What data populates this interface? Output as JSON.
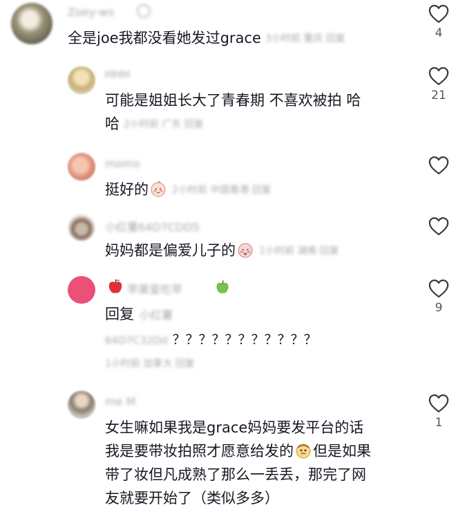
{
  "colors": {
    "text": "#161823",
    "meta": "#a8a9ad",
    "heart": "#3a3a44",
    "count": "#555560"
  },
  "comments": [
    {
      "username": "Zoey-ws",
      "text": "全是joe我都没看她发过grace",
      "meta": "3小时前 重庆 回复",
      "likes": "4"
    },
    {
      "username": "HHH",
      "text_line1": "可能是姐姐长大了青春期 不喜欢被拍 哈",
      "text_line2": "哈",
      "meta": "2小时前 广东 回复",
      "likes": "21"
    },
    {
      "username": "momo",
      "text": "挺好的",
      "meta": "2小时前 中国香港 回复",
      "likes": ""
    },
    {
      "username": "小红薯64D7CDD5",
      "text": "妈妈都是偏爱儿子的",
      "meta": "1小时前 湖南 回复",
      "likes": ""
    },
    {
      "username": "苹果爱吃苹",
      "reply_label": "回复",
      "reply_to": "小红薯",
      "text_line2_blur": "64D7C32Dd",
      "text_line2": "？？？？？？？？？？？",
      "meta": "1小时前 加拿大 回复",
      "likes": "9"
    },
    {
      "username": "me M",
      "text_line1": "女生嘛如果我是grace妈妈要发平台的话",
      "text_line2a": "我是要带妆拍照才愿意给发的",
      "text_line2b": "但是如果",
      "text_line3": "带了妆但凡成熟了那么一丢丢，那完了网",
      "text_line4": "友就要开始了（类似多多）",
      "likes": "1"
    }
  ]
}
